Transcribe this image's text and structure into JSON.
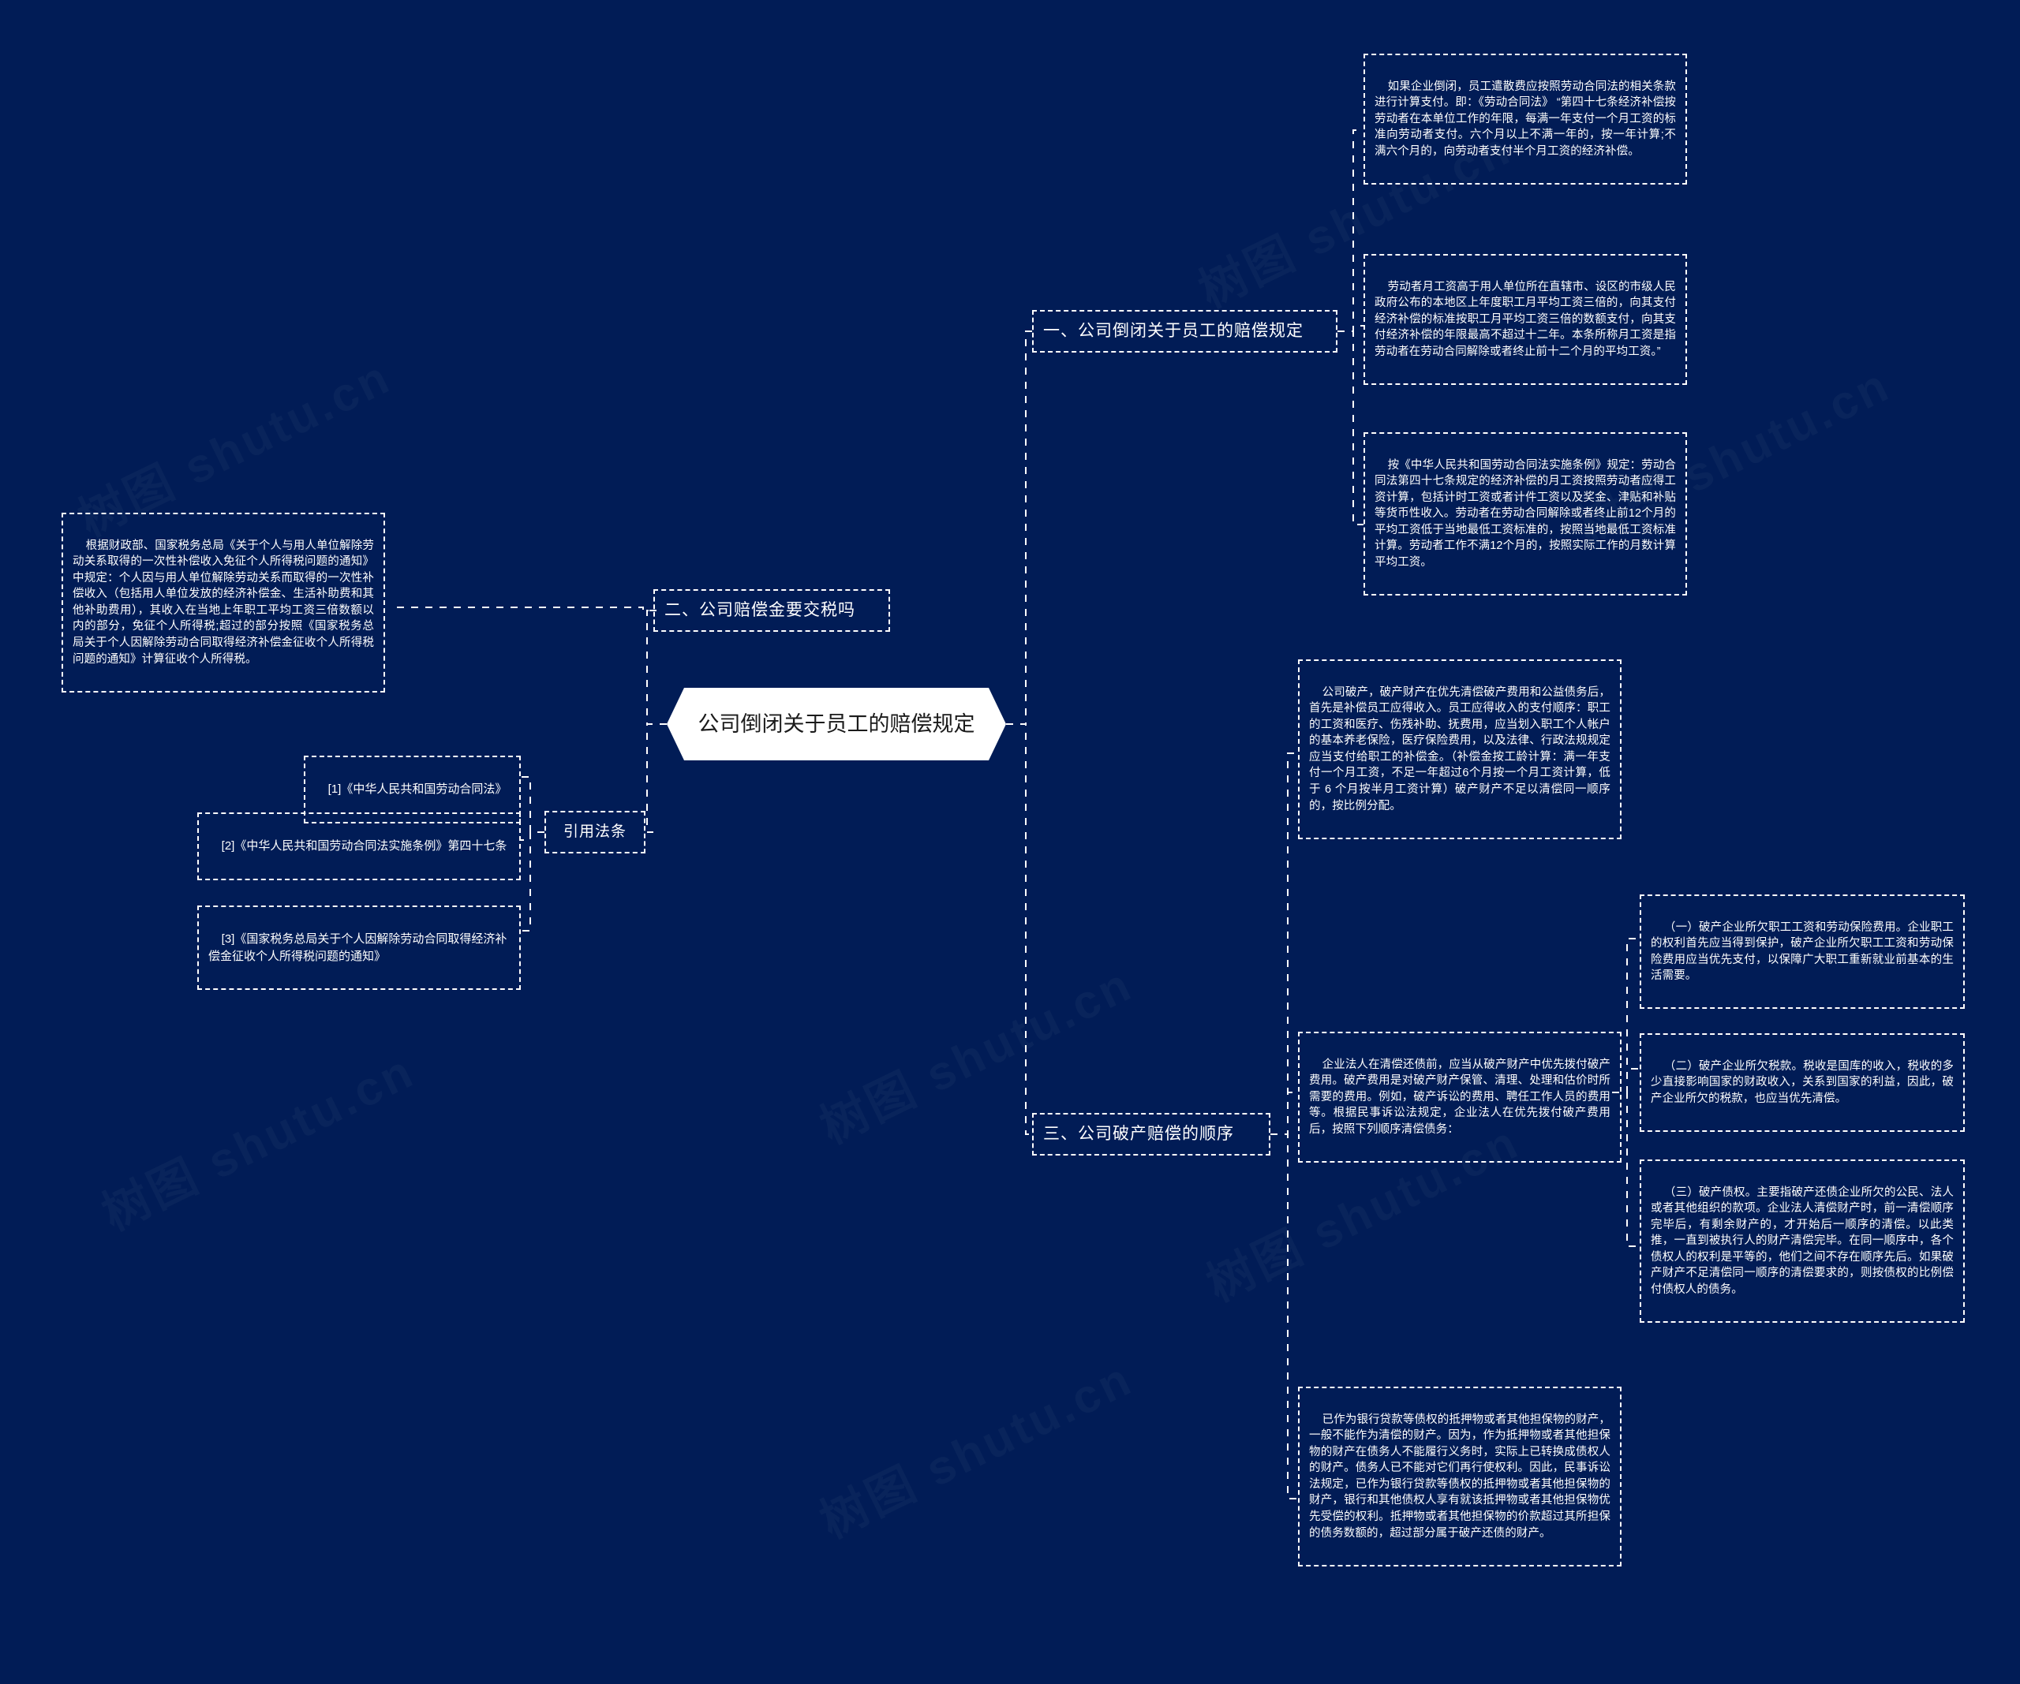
{
  "meta": {
    "background_color": "#011c56",
    "node_text_color": "#ffffff",
    "central_bg_color": "#ffffff",
    "central_text_color": "#1b1b1b",
    "watermark_text": "树图 shutu.cn"
  },
  "central": {
    "title": "公司倒闭关于员工的赔偿规定"
  },
  "branches": [
    {
      "label": "一、公司倒闭关于员工的赔偿规定"
    },
    {
      "label": "二、公司赔偿金要交税吗"
    },
    {
      "label": "三、公司破产赔偿的顺序"
    },
    {
      "label": "引用法条"
    }
  ],
  "leaves": {
    "b1_1": "如果企业倒闭，员工遣散费应按照劳动合同法的相关条款进行计算支付。即：《劳动合同法》 “第四十七条经济补偿按劳动者在本单位工作的年限，每满一年支付一个月工资的标准向劳动者支付。六个月以上不满一年的，按一年计算;不满六个月的，向劳动者支付半个月工资的经济补偿。",
    "b1_2": "劳动者月工资高于用人单位所在直辖市、设区的市级人民政府公布的本地区上年度职工月平均工资三倍的，向其支付经济补偿的标准按职工月平均工资三倍的数额支付，向其支付经济补偿的年限最高不超过十二年。本条所称月工资是指劳动者在劳动合同解除或者终止前十二个月的平均工资。”",
    "b1_3": "按《中华人民共和国劳动合同法实施条例》规定：劳动合同法第四十七条规定的经济补偿的月工资按照劳动者应得工资计算，包括计时工资或者计件工资以及奖金、津贴和补贴等货币性收入。劳动者在劳动合同解除或者终止前12个月的平均工资低于当地最低工资标准的，按照当地最低工资标准计算。劳动者工作不满12个月的，按照实际工作的月数计算平均工资。",
    "b2_1": "根据财政部、国家税务总局《关于个人与用人单位解除劳动关系取得的一次性补偿收入免征个人所得税问题的通知》中规定：个人因与用人单位解除劳动关系而取得的一次性补偿收入（包括用人单位发放的经济补偿金、生活补助费和其他补助费用），其收入在当地上年职工平均工资三倍数额以内的部分，免征个人所得税;超过的部分按照《国家税务总局关于个人因解除劳动合同取得经济补偿金征收个人所得税问题的通知》计算征收个人所得税。",
    "b3_1": "公司破产，破产财产在优先清偿破产费用和公益债务后，首先是补偿员工应得收入。员工应得收入的支付顺序：职工的工资和医疗、伤残补助、抚费用，应当划入职工个人帐户的基本养老保险，医疗保险费用，以及法律、行政法规规定应当支付给职工的补偿金。（补偿金按工龄计算：满一年支付一个月工资，不足一年超过6个月按一个月工资计算，低于 6 个月按半月工资计算）破产财产不足以清偿同一顺序的，按比例分配。",
    "b3_2": "企业法人在清偿还债前，应当从破产财产中优先拨付破产费用。破产费用是对破产财产保管、清理、处理和估价时所需要的费用。例如，破产诉讼的费用、聘任工作人员的费用等。根据民事诉讼法规定，企业法人在优先拨付破产费用后，按照下列顺序清偿债务：",
    "b3_2_a": "（一）破产企业所欠职工工资和劳动保险费用。企业职工的权利首先应当得到保护，破产企业所欠职工工资和劳动保险费用应当优先支付，以保障广大职工重新就业前基本的生活需要。",
    "b3_2_b": "（二）破产企业所欠税款。税收是国库的收入，税收的多少直接影响国家的财政收入，关系到国家的利益，因此，破产企业所欠的税款，也应当优先清偿。",
    "b3_2_c": "（三）破产债权。主要指破产还债企业所欠的公民、法人或者其他组织的款项。企业法人清偿财产时，前一清偿顺序完毕后，有剩余财产的，才开始后一顺序的清偿。以此类推，一直到被执行人的财产清偿完毕。在同一顺序中，各个债权人的权利是平等的，他们之间不存在顺序先后。如果破产财产不足清偿同一顺序的清偿要求的，则按债权的比例偿付债权人的债务。",
    "b3_3": "已作为银行贷款等债权的抵押物或者其他担保物的财产，一般不能作为清偿的财产。因为，作为抵押物或者其他担保物的财产在债务人不能履行义务时，实际上已转换成债权人的财产。债务人已不能对它们再行使权利。因此，民事诉讼法规定，已作为银行贷款等债权的抵押物或者其他担保物的财产，银行和其他债权人享有就该抵押物或者其他担保物优先受偿的权利。抵押物或者其他担保物的价款超过其所担保的债务数额的，超过部分属于破产还债的财产。"
  },
  "references": [
    {
      "label": "[1]《中华人民共和国劳动合同法》"
    },
    {
      "label": "[2]《中华人民共和国劳动合同法实施条例》第四十七条"
    },
    {
      "label": "[3]《国家税务总局关于个人因解除劳动合同取得经济补偿金征收个人所得税问题的通知》"
    }
  ]
}
